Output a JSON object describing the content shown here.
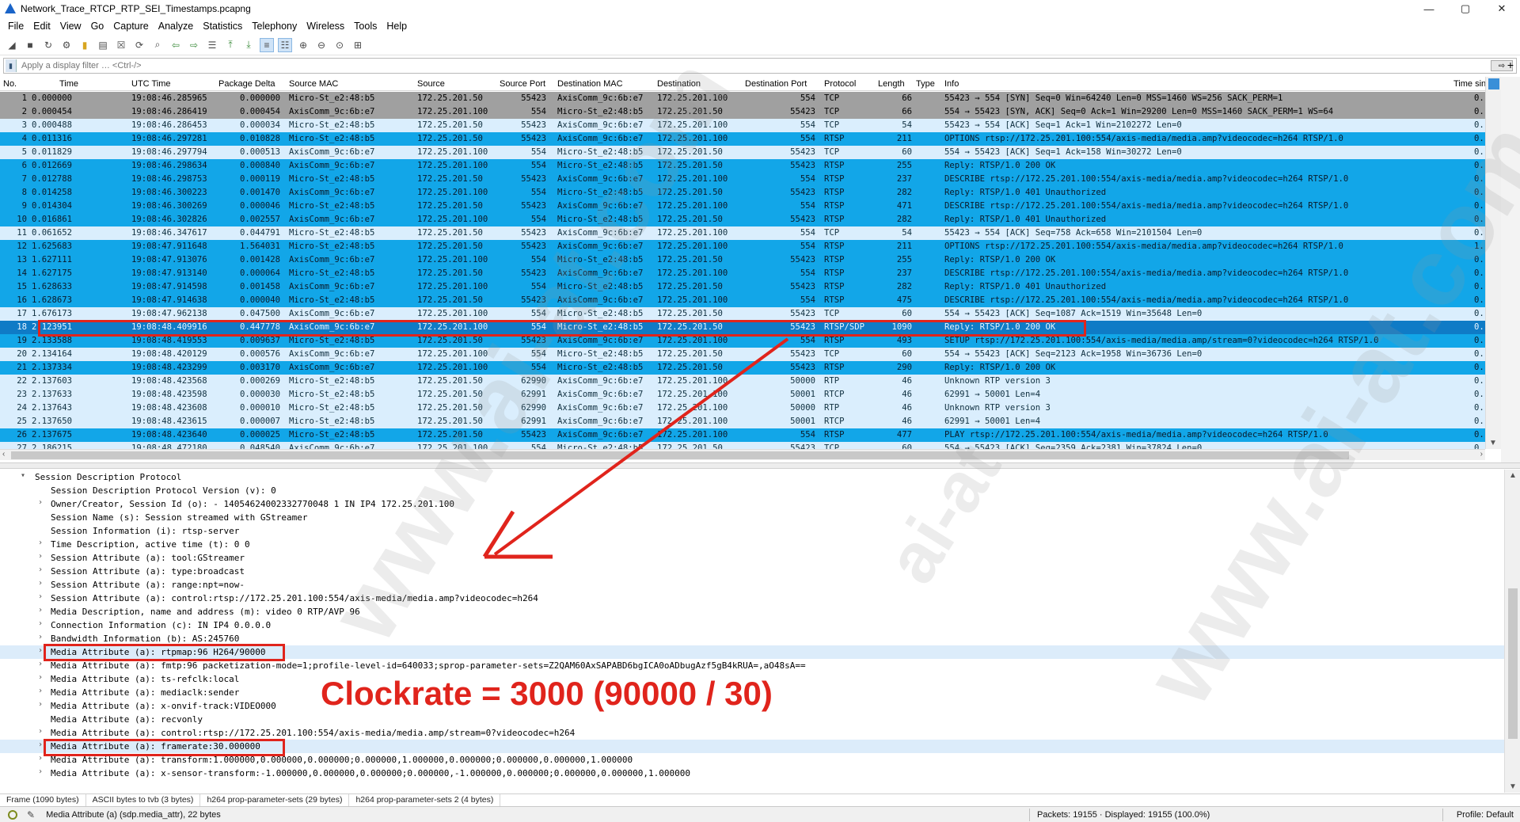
{
  "window": {
    "title": "Network_Trace_RTCP_RTP_SEI_Timestamps.pcapng",
    "controls": [
      "—",
      "▢",
      "✕"
    ]
  },
  "menu": [
    "File",
    "Edit",
    "View",
    "Go",
    "Capture",
    "Analyze",
    "Statistics",
    "Telephony",
    "Wireless",
    "Tools",
    "Help"
  ],
  "toolbar": {
    "icons": [
      "shark-fin-start-icon",
      "stop-capture-icon",
      "restart-capture-icon",
      "capture-options-icon",
      "open-file-icon",
      "save-file-icon",
      "close-file-icon",
      "reload-file-icon",
      "find-packet-icon",
      "go-back-icon",
      "go-forward-icon",
      "go-to-packet-icon",
      "go-first-icon",
      "go-last-icon",
      "autoscroll-icon",
      "colorize-icon",
      "zoom-in-icon",
      "zoom-out-icon",
      "normal-size-icon",
      "resize-columns-icon"
    ]
  },
  "filter": {
    "placeholder": "Apply a display filter … <Ctrl-/>",
    "apply_label": "⇨",
    "add_label": "+"
  },
  "packet_list": {
    "columns": [
      "No.",
      "Time",
      "UTC Time",
      "Package Delta",
      "Source MAC",
      "Source",
      "Source Port",
      "Destination MAC",
      "Destination",
      "Destination Port",
      "Protocol",
      "Length",
      "Type",
      "Info",
      "Time sin"
    ],
    "rows": [
      {
        "no": "1",
        "time": "0.000000",
        "utc": "19:08:46.285965",
        "delta": "0.000000",
        "smac": "Micro-St_e2:48:b5",
        "src": "172.25.201.50",
        "sport": "55423",
        "dmac": "AxisComm_9c:6b:e7",
        "dst": "172.25.201.100",
        "dport": "554",
        "proto": "TCP",
        "len": "66",
        "type": "",
        "info": "55423 → 554 [SYN] Seq=0 Win=64240 Len=0 MSS=1460 WS=256 SACK_PERM=1",
        "tsin": "0.",
        "color": "gray"
      },
      {
        "no": "2",
        "time": "0.000454",
        "utc": "19:08:46.286419",
        "delta": "0.000454",
        "smac": "AxisComm_9c:6b:e7",
        "src": "172.25.201.100",
        "sport": "554",
        "dmac": "Micro-St_e2:48:b5",
        "dst": "172.25.201.50",
        "dport": "55423",
        "proto": "TCP",
        "len": "66",
        "type": "",
        "info": "554 → 55423 [SYN, ACK] Seq=0 Ack=1 Win=29200 Len=0 MSS=1460 SACK_PERM=1 WS=64",
        "tsin": "0.",
        "color": "gray"
      },
      {
        "no": "3",
        "time": "0.000488",
        "utc": "19:08:46.286453",
        "delta": "0.000034",
        "smac": "Micro-St_e2:48:b5",
        "src": "172.25.201.50",
        "sport": "55423",
        "dmac": "AxisComm_9c:6b:e7",
        "dst": "172.25.201.100",
        "dport": "554",
        "proto": "TCP",
        "len": "54",
        "type": "",
        "info": "55423 → 554 [ACK] Seq=1 Ack=1 Win=2102272 Len=0",
        "tsin": "0.",
        "color": "light"
      },
      {
        "no": "4",
        "time": "0.011316",
        "utc": "19:08:46.297281",
        "delta": "0.010828",
        "smac": "Micro-St_e2:48:b5",
        "src": "172.25.201.50",
        "sport": "55423",
        "dmac": "AxisComm_9c:6b:e7",
        "dst": "172.25.201.100",
        "dport": "554",
        "proto": "RTSP",
        "len": "211",
        "type": "",
        "info": "OPTIONS rtsp://172.25.201.100:554/axis-media/media.amp?videocodec=h264 RTSP/1.0",
        "tsin": "0.",
        "color": "blue"
      },
      {
        "no": "5",
        "time": "0.011829",
        "utc": "19:08:46.297794",
        "delta": "0.000513",
        "smac": "AxisComm_9c:6b:e7",
        "src": "172.25.201.100",
        "sport": "554",
        "dmac": "Micro-St_e2:48:b5",
        "dst": "172.25.201.50",
        "dport": "55423",
        "proto": "TCP",
        "len": "60",
        "type": "",
        "info": "554 → 55423 [ACK] Seq=1 Ack=158 Win=30272 Len=0",
        "tsin": "0.",
        "color": "light"
      },
      {
        "no": "6",
        "time": "0.012669",
        "utc": "19:08:46.298634",
        "delta": "0.000840",
        "smac": "AxisComm_9c:6b:e7",
        "src": "172.25.201.100",
        "sport": "554",
        "dmac": "Micro-St_e2:48:b5",
        "dst": "172.25.201.50",
        "dport": "55423",
        "proto": "RTSP",
        "len": "255",
        "type": "",
        "info": "Reply: RTSP/1.0 200 OK",
        "tsin": "0.",
        "color": "blue"
      },
      {
        "no": "7",
        "time": "0.012788",
        "utc": "19:08:46.298753",
        "delta": "0.000119",
        "smac": "Micro-St_e2:48:b5",
        "src": "172.25.201.50",
        "sport": "55423",
        "dmac": "AxisComm_9c:6b:e7",
        "dst": "172.25.201.100",
        "dport": "554",
        "proto": "RTSP",
        "len": "237",
        "type": "",
        "info": "DESCRIBE rtsp://172.25.201.100:554/axis-media/media.amp?videocodec=h264 RTSP/1.0",
        "tsin": "0.",
        "color": "blue"
      },
      {
        "no": "8",
        "time": "0.014258",
        "utc": "19:08:46.300223",
        "delta": "0.001470",
        "smac": "AxisComm_9c:6b:e7",
        "src": "172.25.201.100",
        "sport": "554",
        "dmac": "Micro-St_e2:48:b5",
        "dst": "172.25.201.50",
        "dport": "55423",
        "proto": "RTSP",
        "len": "282",
        "type": "",
        "info": "Reply: RTSP/1.0 401 Unauthorized",
        "tsin": "0.",
        "color": "blue"
      },
      {
        "no": "9",
        "time": "0.014304",
        "utc": "19:08:46.300269",
        "delta": "0.000046",
        "smac": "Micro-St_e2:48:b5",
        "src": "172.25.201.50",
        "sport": "55423",
        "dmac": "AxisComm_9c:6b:e7",
        "dst": "172.25.201.100",
        "dport": "554",
        "proto": "RTSP",
        "len": "471",
        "type": "",
        "info": "DESCRIBE rtsp://172.25.201.100:554/axis-media/media.amp?videocodec=h264 RTSP/1.0",
        "tsin": "0.",
        "color": "blue"
      },
      {
        "no": "10",
        "time": "0.016861",
        "utc": "19:08:46.302826",
        "delta": "0.002557",
        "smac": "AxisComm_9c:6b:e7",
        "src": "172.25.201.100",
        "sport": "554",
        "dmac": "Micro-St_e2:48:b5",
        "dst": "172.25.201.50",
        "dport": "55423",
        "proto": "RTSP",
        "len": "282",
        "type": "",
        "info": "Reply: RTSP/1.0 401 Unauthorized",
        "tsin": "0.",
        "color": "blue"
      },
      {
        "no": "11",
        "time": "0.061652",
        "utc": "19:08:46.347617",
        "delta": "0.044791",
        "smac": "Micro-St_e2:48:b5",
        "src": "172.25.201.50",
        "sport": "55423",
        "dmac": "AxisComm_9c:6b:e7",
        "dst": "172.25.201.100",
        "dport": "554",
        "proto": "TCP",
        "len": "54",
        "type": "",
        "info": "55423 → 554 [ACK] Seq=758 Ack=658 Win=2101504 Len=0",
        "tsin": "0.",
        "color": "light"
      },
      {
        "no": "12",
        "time": "1.625683",
        "utc": "19:08:47.911648",
        "delta": "1.564031",
        "smac": "Micro-St_e2:48:b5",
        "src": "172.25.201.50",
        "sport": "55423",
        "dmac": "AxisComm_9c:6b:e7",
        "dst": "172.25.201.100",
        "dport": "554",
        "proto": "RTSP",
        "len": "211",
        "type": "",
        "info": "OPTIONS rtsp://172.25.201.100:554/axis-media/media.amp?videocodec=h264 RTSP/1.0",
        "tsin": "1.",
        "color": "blue"
      },
      {
        "no": "13",
        "time": "1.627111",
        "utc": "19:08:47.913076",
        "delta": "0.001428",
        "smac": "AxisComm_9c:6b:e7",
        "src": "172.25.201.100",
        "sport": "554",
        "dmac": "Micro-St_e2:48:b5",
        "dst": "172.25.201.50",
        "dport": "55423",
        "proto": "RTSP",
        "len": "255",
        "type": "",
        "info": "Reply: RTSP/1.0 200 OK",
        "tsin": "0.",
        "color": "blue"
      },
      {
        "no": "14",
        "time": "1.627175",
        "utc": "19:08:47.913140",
        "delta": "0.000064",
        "smac": "Micro-St_e2:48:b5",
        "src": "172.25.201.50",
        "sport": "55423",
        "dmac": "AxisComm_9c:6b:e7",
        "dst": "172.25.201.100",
        "dport": "554",
        "proto": "RTSP",
        "len": "237",
        "type": "",
        "info": "DESCRIBE rtsp://172.25.201.100:554/axis-media/media.amp?videocodec=h264 RTSP/1.0",
        "tsin": "0.",
        "color": "blue"
      },
      {
        "no": "15",
        "time": "1.628633",
        "utc": "19:08:47.914598",
        "delta": "0.001458",
        "smac": "AxisComm_9c:6b:e7",
        "src": "172.25.201.100",
        "sport": "554",
        "dmac": "Micro-St_e2:48:b5",
        "dst": "172.25.201.50",
        "dport": "55423",
        "proto": "RTSP",
        "len": "282",
        "type": "",
        "info": "Reply: RTSP/1.0 401 Unauthorized",
        "tsin": "0.",
        "color": "blue"
      },
      {
        "no": "16",
        "time": "1.628673",
        "utc": "19:08:47.914638",
        "delta": "0.000040",
        "smac": "Micro-St_e2:48:b5",
        "src": "172.25.201.50",
        "sport": "55423",
        "dmac": "AxisComm_9c:6b:e7",
        "dst": "172.25.201.100",
        "dport": "554",
        "proto": "RTSP",
        "len": "475",
        "type": "",
        "info": "DESCRIBE rtsp://172.25.201.100:554/axis-media/media.amp?videocodec=h264 RTSP/1.0",
        "tsin": "0.",
        "color": "blue"
      },
      {
        "no": "17",
        "time": "1.676173",
        "utc": "19:08:47.962138",
        "delta": "0.047500",
        "smac": "AxisComm_9c:6b:e7",
        "src": "172.25.201.100",
        "sport": "554",
        "dmac": "Micro-St_e2:48:b5",
        "dst": "172.25.201.50",
        "dport": "55423",
        "proto": "TCP",
        "len": "60",
        "type": "",
        "info": "554 → 55423 [ACK] Seq=1087 Ack=1519 Win=35648 Len=0",
        "tsin": "0.",
        "color": "light"
      },
      {
        "no": "18",
        "time": "2.123951",
        "utc": "19:08:48.409916",
        "delta": "0.447778",
        "smac": "AxisComm_9c:6b:e7",
        "src": "172.25.201.100",
        "sport": "554",
        "dmac": "Micro-St_e2:48:b5",
        "dst": "172.25.201.50",
        "dport": "55423",
        "proto": "RTSP/SDP",
        "len": "1090",
        "type": "",
        "info": "Reply: RTSP/1.0 200 OK",
        "tsin": "0.",
        "color": "sel"
      },
      {
        "no": "19",
        "time": "2.133588",
        "utc": "19:08:48.419553",
        "delta": "0.009637",
        "smac": "Micro-St_e2:48:b5",
        "src": "172.25.201.50",
        "sport": "55423",
        "dmac": "AxisComm_9c:6b:e7",
        "dst": "172.25.201.100",
        "dport": "554",
        "proto": "RTSP",
        "len": "493",
        "type": "",
        "info": "SETUP rtsp://172.25.201.100:554/axis-media/media.amp/stream=0?videocodec=h264 RTSP/1.0",
        "tsin": "0.",
        "color": "blue"
      },
      {
        "no": "20",
        "time": "2.134164",
        "utc": "19:08:48.420129",
        "delta": "0.000576",
        "smac": "AxisComm_9c:6b:e7",
        "src": "172.25.201.100",
        "sport": "554",
        "dmac": "Micro-St_e2:48:b5",
        "dst": "172.25.201.50",
        "dport": "55423",
        "proto": "TCP",
        "len": "60",
        "type": "",
        "info": "554 → 55423 [ACK] Seq=2123 Ack=1958 Win=36736 Len=0",
        "tsin": "0.",
        "color": "light"
      },
      {
        "no": "21",
        "time": "2.137334",
        "utc": "19:08:48.423299",
        "delta": "0.003170",
        "smac": "AxisComm_9c:6b:e7",
        "src": "172.25.201.100",
        "sport": "554",
        "dmac": "Micro-St_e2:48:b5",
        "dst": "172.25.201.50",
        "dport": "55423",
        "proto": "RTSP",
        "len": "290",
        "type": "",
        "info": "Reply: RTSP/1.0 200 OK",
        "tsin": "0.",
        "color": "blue"
      },
      {
        "no": "22",
        "time": "2.137603",
        "utc": "19:08:48.423568",
        "delta": "0.000269",
        "smac": "Micro-St_e2:48:b5",
        "src": "172.25.201.50",
        "sport": "62990",
        "dmac": "AxisComm_9c:6b:e7",
        "dst": "172.25.201.100",
        "dport": "50000",
        "proto": "RTP",
        "len": "46",
        "type": "",
        "info": "Unknown RTP version 3",
        "tsin": "0.",
        "color": "light"
      },
      {
        "no": "23",
        "time": "2.137633",
        "utc": "19:08:48.423598",
        "delta": "0.000030",
        "smac": "Micro-St_e2:48:b5",
        "src": "172.25.201.50",
        "sport": "62991",
        "dmac": "AxisComm_9c:6b:e7",
        "dst": "172.25.201.100",
        "dport": "50001",
        "proto": "RTCP",
        "len": "46",
        "type": "",
        "info": "62991 → 50001 Len=4",
        "tsin": "0.",
        "color": "light"
      },
      {
        "no": "24",
        "time": "2.137643",
        "utc": "19:08:48.423608",
        "delta": "0.000010",
        "smac": "Micro-St_e2:48:b5",
        "src": "172.25.201.50",
        "sport": "62990",
        "dmac": "AxisComm_9c:6b:e7",
        "dst": "172.25.201.100",
        "dport": "50000",
        "proto": "RTP",
        "len": "46",
        "type": "",
        "info": "Unknown RTP version 3",
        "tsin": "0.",
        "color": "light"
      },
      {
        "no": "25",
        "time": "2.137650",
        "utc": "19:08:48.423615",
        "delta": "0.000007",
        "smac": "Micro-St_e2:48:b5",
        "src": "172.25.201.50",
        "sport": "62991",
        "dmac": "AxisComm_9c:6b:e7",
        "dst": "172.25.201.100",
        "dport": "50001",
        "proto": "RTCP",
        "len": "46",
        "type": "",
        "info": "62991 → 50001 Len=4",
        "tsin": "0.",
        "color": "light"
      },
      {
        "no": "26",
        "time": "2.137675",
        "utc": "19:08:48.423640",
        "delta": "0.000025",
        "smac": "Micro-St_e2:48:b5",
        "src": "172.25.201.50",
        "sport": "55423",
        "dmac": "AxisComm_9c:6b:e7",
        "dst": "172.25.201.100",
        "dport": "554",
        "proto": "RTSP",
        "len": "477",
        "type": "",
        "info": "PLAY rtsp://172.25.201.100:554/axis-media/media.amp?videocodec=h264 RTSP/1.0",
        "tsin": "0.",
        "color": "blue"
      },
      {
        "no": "27",
        "time": "2.186215",
        "utc": "19:08:48.472180",
        "delta": "0.048540",
        "smac": "AxisComm_9c:6b:e7",
        "src": "172.25.201.100",
        "sport": "554",
        "dmac": "Micro-St_e2:48:b5",
        "dst": "172.25.201.50",
        "dport": "55423",
        "proto": "TCP",
        "len": "60",
        "type": "",
        "info": "554 → 55423 [ACK] Seq=2359 Ack=2381 Win=37824 Len=0",
        "tsin": "0.",
        "color": "light"
      }
    ]
  },
  "details": {
    "lines": [
      {
        "toggle": "▾",
        "text": "Session Description Protocol",
        "hl": false,
        "indent": 0
      },
      {
        "toggle": "",
        "text": "Session Description Protocol Version (v): 0",
        "hl": false,
        "indent": 1
      },
      {
        "toggle": "›",
        "text": "Owner/Creator, Session Id (o): - 1405462400233277004​8 1 IN IP4 172.25.201.100",
        "hl": false,
        "indent": 1
      },
      {
        "toggle": "",
        "text": "Session Name (s): Session streamed with GStreamer",
        "hl": false,
        "indent": 1
      },
      {
        "toggle": "",
        "text": "Session Information (i): rtsp-server",
        "hl": false,
        "indent": 1
      },
      {
        "toggle": "›",
        "text": "Time Description, active time (t): 0 0",
        "hl": false,
        "indent": 1
      },
      {
        "toggle": "›",
        "text": "Session Attribute (a): tool:GStreamer",
        "hl": false,
        "indent": 1
      },
      {
        "toggle": "›",
        "text": "Session Attribute (a): type:broadcast",
        "hl": false,
        "indent": 1
      },
      {
        "toggle": "›",
        "text": "Session Attribute (a): range:npt=now-",
        "hl": false,
        "indent": 1
      },
      {
        "toggle": "›",
        "text": "Session Attribute (a): control:rtsp://172.25.201.100:554/axis-media/media.amp?videocodec=h264",
        "hl": false,
        "indent": 1
      },
      {
        "toggle": "›",
        "text": "Media Description, name and address (m): video 0 RTP/AVP 96",
        "hl": false,
        "indent": 1
      },
      {
        "toggle": "›",
        "text": "Connection Information (c): IN IP4 0.0.0.0",
        "hl": false,
        "indent": 1
      },
      {
        "toggle": "›",
        "text": "Bandwidth Information (b): AS:245760",
        "hl": false,
        "indent": 1
      },
      {
        "toggle": "›",
        "text": "Media Attribute (a): rtpmap:96 H264/90000",
        "hl": true,
        "indent": 1
      },
      {
        "toggle": "›",
        "text": "Media Attribute (a): fmtp:96 packetization-mode=1;profile-level-id=640033;sprop-parameter-sets=Z2QAM60AxSAPABD6bgICA0oADbugAzf5gB4kRUA=,aO48sA==",
        "hl": false,
        "indent": 1
      },
      {
        "toggle": "›",
        "text": "Media Attribute (a): ts-refclk:local",
        "hl": false,
        "indent": 1
      },
      {
        "toggle": "›",
        "text": "Media Attribute (a): mediaclk:sender",
        "hl": false,
        "indent": 1
      },
      {
        "toggle": "›",
        "text": "Media Attribute (a): x-onvif-track:VIDEO000",
        "hl": false,
        "indent": 1
      },
      {
        "toggle": "",
        "text": "Media Attribute (a): recvonly",
        "hl": false,
        "indent": 1
      },
      {
        "toggle": "›",
        "text": "Media Attribute (a): control:rtsp://172.25.201.100:554/axis-media/media.amp/stream=0?videocodec=h264",
        "hl": false,
        "indent": 1
      },
      {
        "toggle": "›",
        "text": "Media Attribute (a): framerate:30.000000",
        "hl": true,
        "indent": 1
      },
      {
        "toggle": "›",
        "text": "Media Attribute (a): transform:1.000000,0.000000,0.000000;0.000000,1.000000,0.000000;0.000000,0.000000,1.000000",
        "hl": false,
        "indent": 1
      },
      {
        "toggle": "›",
        "text": "Media Attribute (a): x-sensor-transform:-1.000000,0.000000,0.000000;0.000000,-1.000000,0.000000;0.000000,0.000000,1.000000",
        "hl": false,
        "indent": 1
      }
    ]
  },
  "bytes_tabs": [
    "Frame (1090 bytes)",
    "ASCII bytes to tvb (3 bytes)",
    "h264 prop-parameter-sets (29 bytes)",
    "h264 prop-parameter-sets 2 (4 bytes)"
  ],
  "status": {
    "field": "Media Attribute (a) (sdp.media_attr), 22 bytes",
    "packets": "Packets: 19155 · Displayed: 19155 (100.0%)",
    "profile": "Profile: Default"
  },
  "annotation": {
    "text": "Clockrate = 3000 (90000 / 30)",
    "color": "#e0241c"
  },
  "watermark": {
    "text_a": "www.ai-at.com",
    "text_b": "ai-at"
  },
  "colors": {
    "row_gray": "#a0a0a0",
    "row_blue": "#12a6e8",
    "row_light": "#daeefd",
    "row_selected": "#0f7bc6",
    "annotation_red": "#e0241c"
  }
}
